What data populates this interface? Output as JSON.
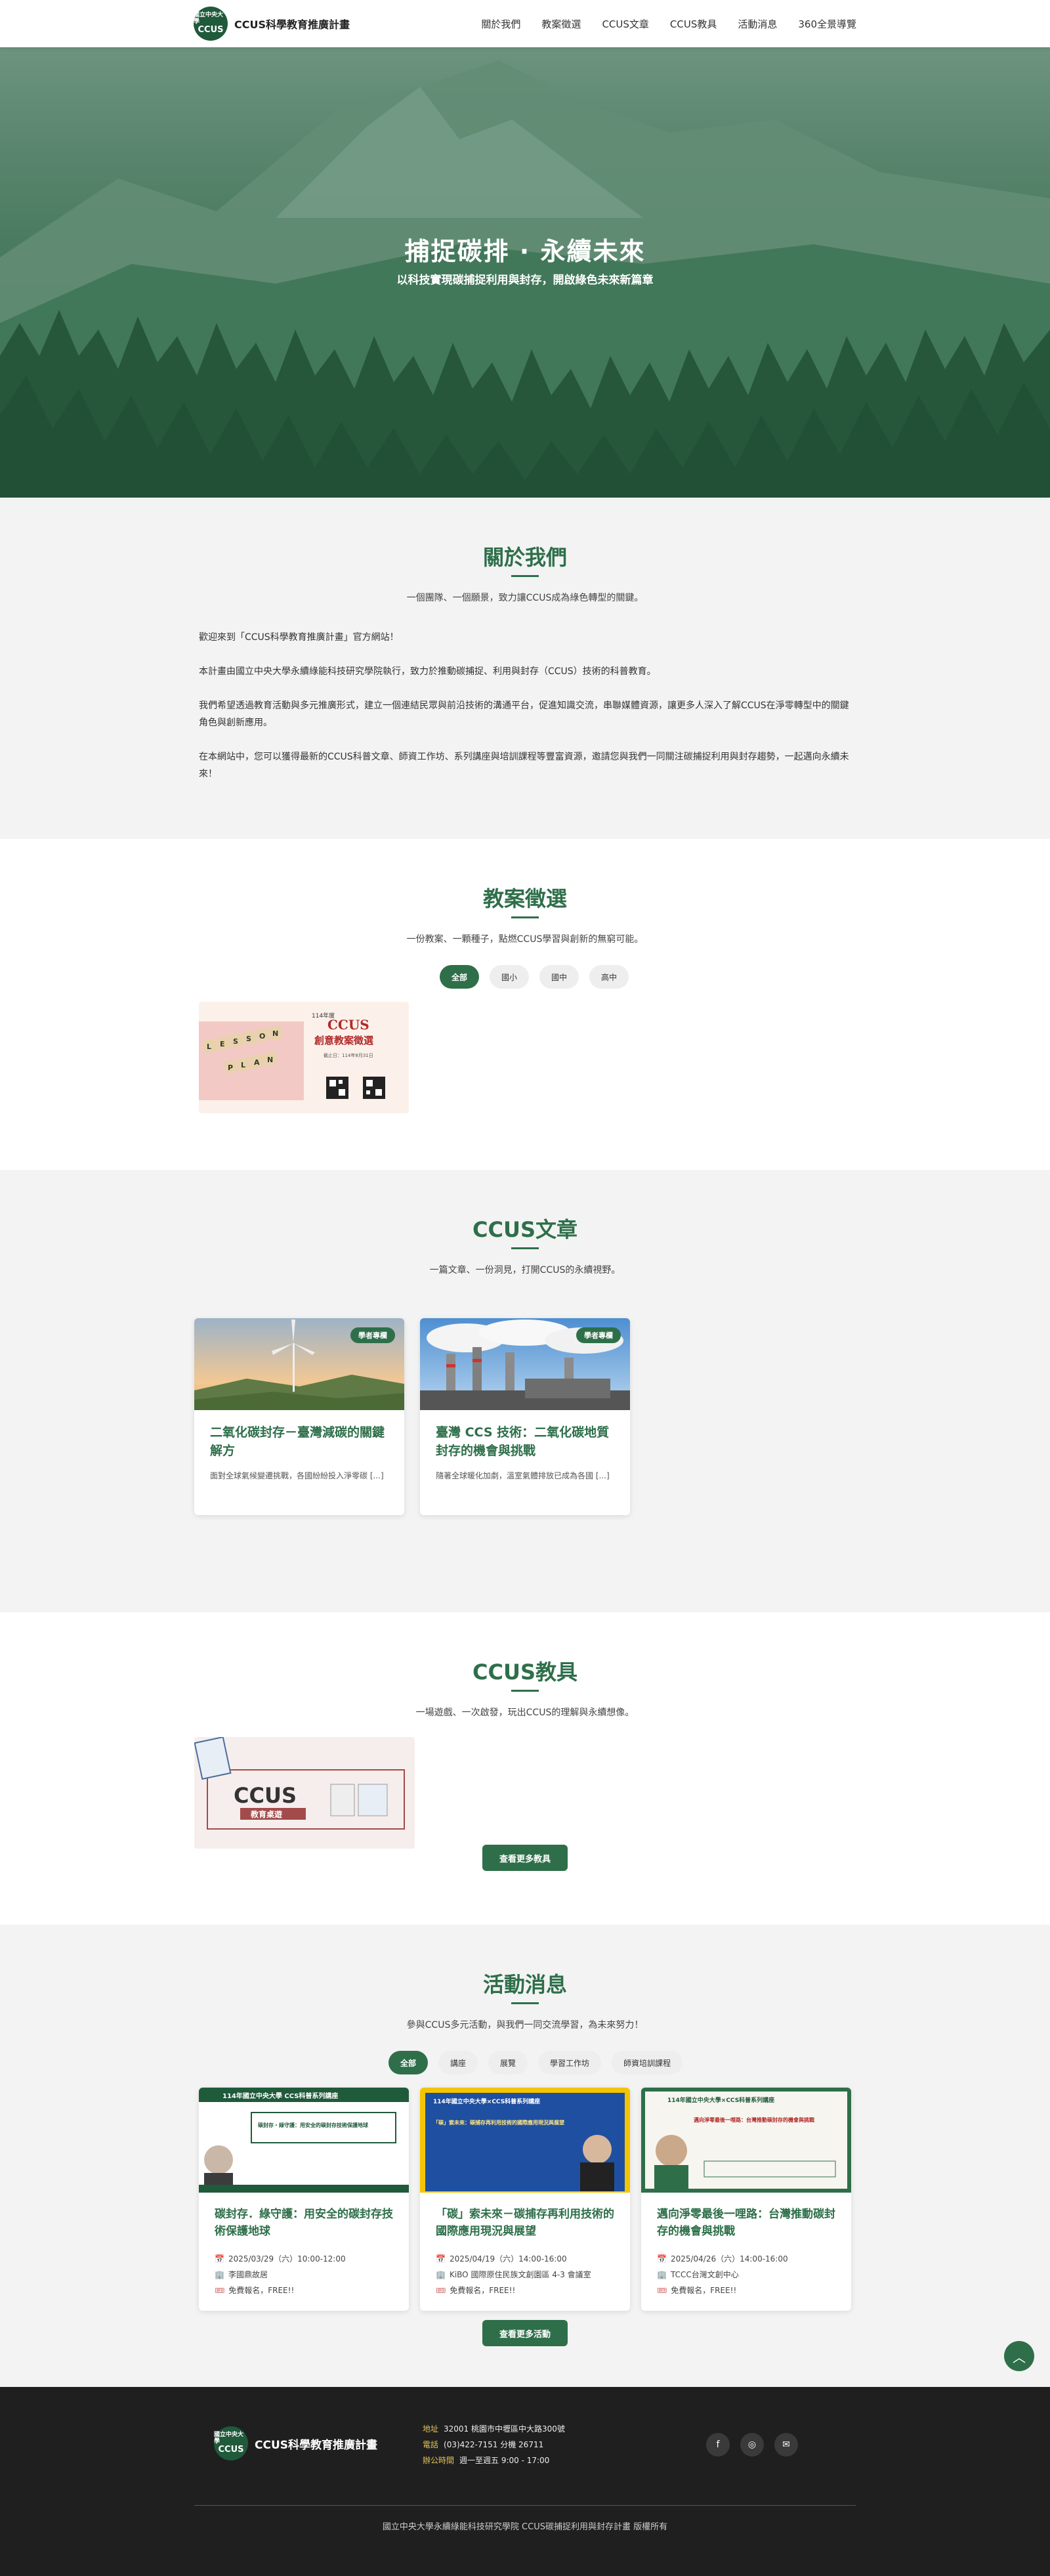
{
  "header": {
    "logo_text_small": "國立中央大學",
    "logo_text_big": "CCUS",
    "brand_name": "CCUS科學教育推廣計畫",
    "nav": [
      "關於我們",
      "教案徵選",
      "CCUS文章",
      "CCUS教具",
      "活動消息",
      "360全景導覽"
    ]
  },
  "hero": {
    "title": "捕捉碳排 · 永續未來",
    "subtitle": "以科技實現碳捕捉利用與封存，開啟綠色未來新篇章"
  },
  "about": {
    "title": "關於我們",
    "subtitle": "一個團隊、一個願景，致力讓CCUS成為綠色轉型的關鍵。",
    "paragraphs": [
      "歡迎來到「CCUS科學教育推廣計畫」官方網站！",
      "本計畫由國立中央大學永續綠能科技研究學院執行，致力於推動碳捕捉、利用與封存（CCUS）技術的科普教育。",
      "我們希望透過教育活動與多元推廣形式，建立一個連結民眾與前沿技術的溝通平台，促進知識交流，串聯媒體資源，讓更多人深入了解CCUS在淨零轉型中的關鍵角色與創新應用。",
      "在本網站中，您可以獲得最新的CCUS科普文章、師資工作坊、系列講座與培訓課程等豐富資源，邀請您與我們一同關注碳捕捉利用與封存趨勢，一起邁向永續未來！"
    ]
  },
  "lesson": {
    "title": "教案徵選",
    "subtitle": "一份教案、一顆種子，點燃CCUS學習與創新的無窮可能。",
    "filters": [
      "全部",
      "國小",
      "國中",
      "高中"
    ],
    "poster": {
      "year": "114年度",
      "title1": "CCUS",
      "title2": "創意教案徵選",
      "tiles": [
        "L",
        "E",
        "S",
        "S",
        "O",
        "N"
      ],
      "tiles2": [
        "P",
        "L",
        "A",
        "N"
      ],
      "deadline": "截止日：114年8月31日"
    }
  },
  "articles": {
    "title": "CCUS文章",
    "subtitle": "一篇文章、一份洞見，打開CCUS的永續視野。",
    "items": [
      {
        "tag": "學者專欄",
        "title": "二氧化碳封存－臺灣減碳的關鍵解方",
        "excerpt": "面對全球氣候變遷挑戰，各國紛紛投入淨零碳 [...]"
      },
      {
        "tag": "學者專欄",
        "title": "臺灣 CCS 技術：二氧化碳地質封存的機會與挑戰",
        "excerpt": "隨著全球暖化加劇，溫室氣體排放已成為各國 [...]"
      }
    ]
  },
  "kits": {
    "title": "CCUS教具",
    "subtitle": "一場遊戲、一次啟發，玩出CCUS的理解與永續想像。",
    "kit": {
      "big": "CCUS",
      "small": "教育桌遊"
    },
    "more_button": "查看更多教具"
  },
  "events": {
    "title": "活動消息",
    "subtitle": "參與CCUS多元活動，與我們一同交流學習，為未來努力！",
    "filters": [
      "全部",
      "講座",
      "展覽",
      "學習工作坊",
      "師資培訓課程"
    ],
    "items": [
      {
        "poster_title": "114年國立中央大學 CCS科普系列講座",
        "poster_sub": "碳封存・綠守護：用安全的碳封存技術保護地球",
        "title": "碳封存．綠守護：用安全的碳封存技術保護地球",
        "date": "2025/03/29（六）10:00-12:00",
        "place": "李國鼎故居",
        "fee": "免費報名，FREE!!"
      },
      {
        "poster_title": "114年國立中央大學×CCS科普系列講座",
        "poster_sub": "「碳」索未來：碳捕存再利用技術的國際應用現況與展望",
        "title": "「碳」索未來－碳捕存再利用技術的國際應用現況與展望",
        "date": "2025/04/19（六）14:00-16:00",
        "place": "KiBO 國際原住民族文創園區 4-3 會議室",
        "fee": "免費報名，FREE!!"
      },
      {
        "poster_title": "114年國立中央大學×CCS科普系列講座",
        "poster_sub": "邁向淨零最後一哩路：台灣推動碳封存的機會與挑戰",
        "title": "邁向淨零最後一哩路：台灣推動碳封存的機會與挑戰",
        "date": "2025/04/26（六）14:00-16:00",
        "place": "TCCC台灣文創中心",
        "fee": "免費報名，FREE!!"
      }
    ],
    "more_button": "查看更多活動"
  },
  "footer": {
    "brand_name": "CCUS科學教育推廣計畫",
    "address_label": "地址",
    "address": "32001 桃園市中壢區中大路300號",
    "phone_label": "電話",
    "phone": "(03)422-7151 分機 26711",
    "hours_label": "辦公時間",
    "hours": "週一至週五 9:00 - 17:00",
    "copyright": "國立中央大學永續綠能科技研究學院 CCUS碳捕捉利用與封存計畫 版權所有"
  },
  "colors": {
    "primary": "#2e6f4a",
    "footer_bg": "#1f1f1f",
    "accent_label": "#e2c25b"
  }
}
